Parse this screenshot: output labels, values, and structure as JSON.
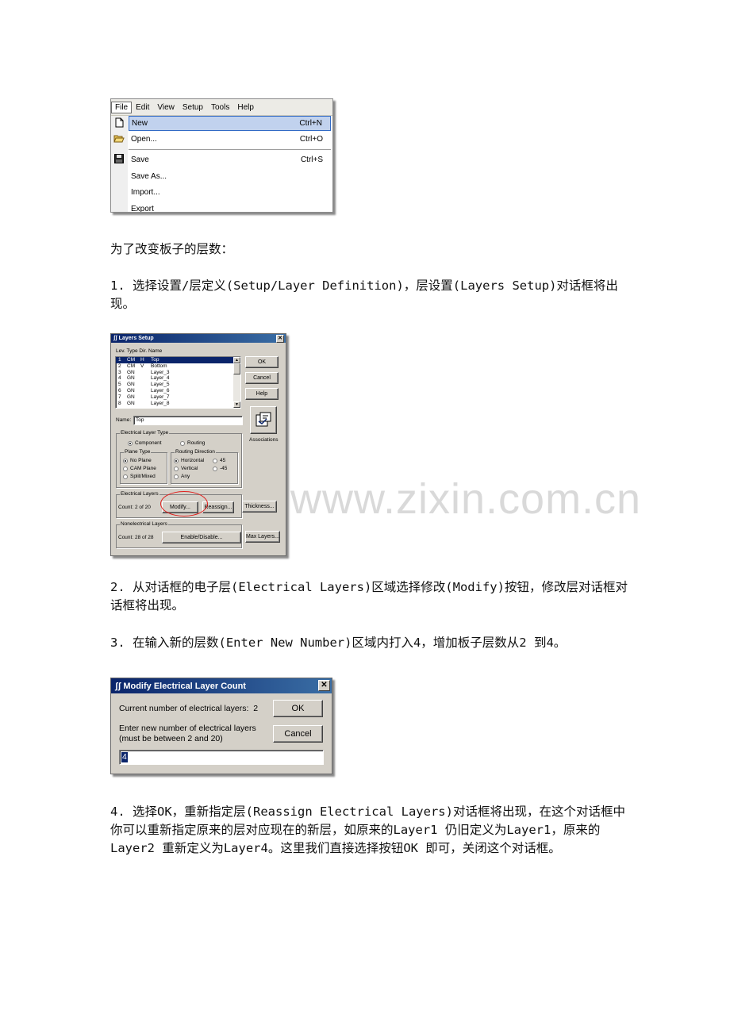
{
  "file_menu": {
    "menubar": [
      "File",
      "Edit",
      "View",
      "Setup",
      "Tools",
      "Help"
    ],
    "items": [
      {
        "label": "New",
        "shortcut": "Ctrl+N",
        "icon": "new-document-icon"
      },
      {
        "label": "Open...",
        "shortcut": "Ctrl+O",
        "icon": "open-folder-icon"
      },
      {
        "label": "Save",
        "shortcut": "Ctrl+S",
        "icon": "floppy-disk-icon"
      },
      {
        "label": "Save As...",
        "shortcut": ""
      },
      {
        "label": "Import...",
        "shortcut": ""
      },
      {
        "label": "Export",
        "shortcut": ""
      }
    ]
  },
  "text": {
    "intro": "为了改变板子的层数：",
    "step1": "1. 选择设置/层定义(Setup/Layer Definition)，层设置(Layers Setup)对话框将出现。",
    "step2": "2. 从对话框的电子层(Electrical Layers)区域选择修改(Modify)按钮，修改层对话框对话框将出现。",
    "step3": "3. 在输入新的层数(Enter New Number)区域内打入4，增加板子层数从2 到4。",
    "step4": "4. 选择OK，重新指定层(Reassign Electrical Layers)对话框将出现，在这个对话框中你可以重新指定原来的层对应现在的新层，如原来的Layer1 仍旧定义为Layer1，原来的Layer2 重新定义为Layer4。这里我们直接选择按钮OK 即可，关闭这个对话框。"
  },
  "layers_setup": {
    "title": "Layers Setup",
    "columns": "Lev.  Type  Dir.  Name",
    "rows": [
      {
        "lev": "1",
        "type": "CM",
        "dir": "H",
        "name": "Top"
      },
      {
        "lev": "2",
        "type": "CM",
        "dir": "V",
        "name": "Bottom"
      },
      {
        "lev": "3",
        "type": "GN",
        "dir": "",
        "name": "Layer_3"
      },
      {
        "lev": "4",
        "type": "GN",
        "dir": "",
        "name": "Layer_4"
      },
      {
        "lev": "5",
        "type": "GN",
        "dir": "",
        "name": "Layer_5"
      },
      {
        "lev": "6",
        "type": "GN",
        "dir": "",
        "name": "Layer_6"
      },
      {
        "lev": "7",
        "type": "GN",
        "dir": "",
        "name": "Layer_7"
      },
      {
        "lev": "8",
        "type": "GN",
        "dir": "",
        "name": "Layer_8"
      }
    ],
    "ok": "OK",
    "cancel": "Cancel",
    "help": "Help",
    "associations": "Associations",
    "name_label": "Name:",
    "name_value": "Top",
    "electrical_layer_type": "Electrical Layer Type",
    "component": "Component",
    "routing": "Routing",
    "plane_type": "Plane Type",
    "no_plane": "No Plane",
    "cam_plane": "CAM Plane",
    "split_mixed": "Split/Mixed",
    "routing_direction": "Routing Direction",
    "horizontal": "Horizontal",
    "vertical": "Vertical",
    "any": "Any",
    "d45": "45",
    "dm45": "-45",
    "electrical_layers": "Electrical Layers",
    "el_count": "Count:  2 of 20",
    "modify": "Modify...",
    "reassign": "Reassign...",
    "thickness": "Thickness...",
    "nonelectrical_layers": "Nonelectrical Layers",
    "nel_count": "Count:  28 of 28",
    "enable_disable": "Enable/Disable...",
    "max_layers": "Max Layers..."
  },
  "modify_dialog": {
    "title": "Modify Electrical Layer Count",
    "current_label": "Current number of electrical layers:",
    "current_value": "2",
    "enter_label_1": "Enter new number of electrical layers",
    "enter_label_2": "(must be between  2 and 20)",
    "input_value": "4",
    "ok": "OK",
    "cancel": "Cancel"
  },
  "watermark": "www.zixin.com.cn"
}
